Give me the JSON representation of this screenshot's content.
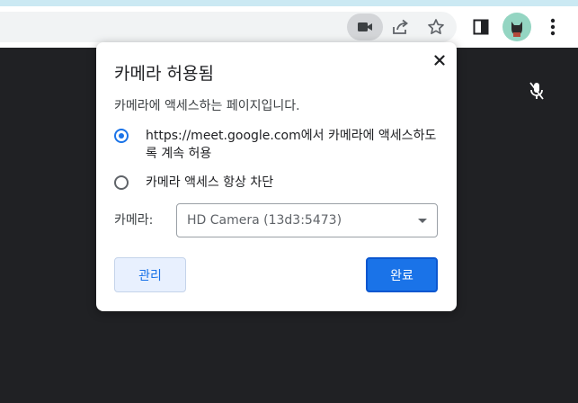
{
  "popup": {
    "title": "카메라 허용됨",
    "description": "카메라에 액세스하는 페이지입니다.",
    "option_allow": "https://meet.google.com에서 카메라에 액세스하도록 계속 허용",
    "option_block": "카메라 액세스 항상 차단",
    "selected_option": "allow",
    "camera_label": "카메라:",
    "camera_select_value": "HD Camera (13d3:5473)",
    "manage_label": "관리",
    "done_label": "완료",
    "close_glyph": "✕"
  },
  "toolbar": {
    "icons": [
      "camera-icon",
      "share-icon",
      "star-icon",
      "side-panel-icon",
      "avatar",
      "more-menu-icon"
    ]
  },
  "colors": {
    "accent": "#1a73e8",
    "page_background": "#202124",
    "top_strip": "#cbe9f3"
  }
}
